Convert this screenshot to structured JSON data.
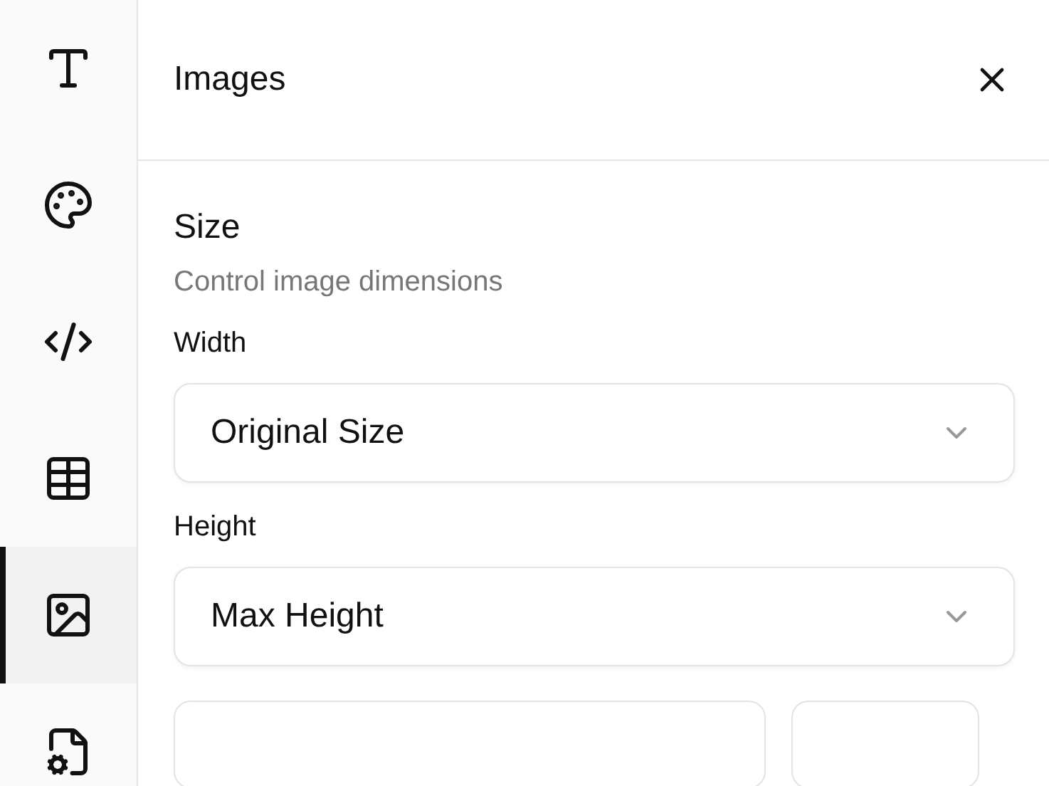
{
  "sidebar": {
    "items": [
      {
        "kind": "text",
        "selected": false
      },
      {
        "kind": "palette",
        "selected": false
      },
      {
        "kind": "code",
        "selected": false
      },
      {
        "kind": "table",
        "selected": false
      },
      {
        "kind": "image",
        "selected": true
      },
      {
        "kind": "file-settings",
        "selected": false
      }
    ]
  },
  "panel": {
    "title": "Images",
    "section": {
      "title": "Size",
      "description": "Control image dimensions",
      "fields": [
        {
          "label": "Width",
          "value": "Original Size"
        },
        {
          "label": "Height",
          "value": "Max Height"
        }
      ]
    }
  }
}
